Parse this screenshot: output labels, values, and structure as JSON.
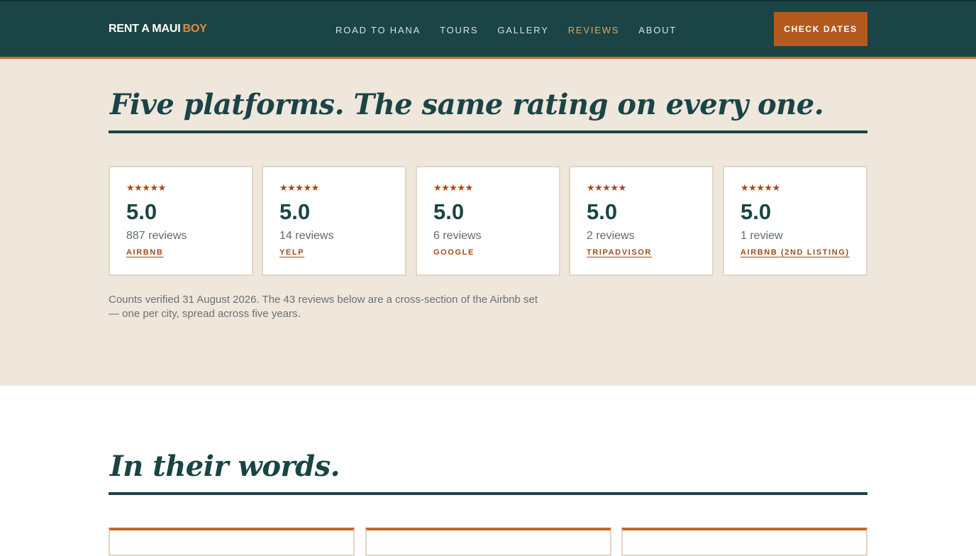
{
  "header": {
    "logo_main": "RENT A MAUI",
    "logo_accent": "BOY",
    "nav": [
      {
        "label": "ROAD TO HANA"
      },
      {
        "label": "TOURS"
      },
      {
        "label": "GALLERY"
      },
      {
        "label": "REVIEWS",
        "active": true
      },
      {
        "label": "ABOUT"
      }
    ],
    "cta_label": "CHECK DATES"
  },
  "ratings_section": {
    "title": "Five platforms. The same rating on every one.",
    "stars": "★★★★★",
    "cards": [
      {
        "rating": "5.0",
        "count": "887 reviews",
        "platform": "AIRBNB"
      },
      {
        "rating": "5.0",
        "count": "14 reviews",
        "platform": "YELP"
      },
      {
        "rating": "5.0",
        "count": "6 reviews",
        "platform": "GOOGLE"
      },
      {
        "rating": "5.0",
        "count": "2 reviews",
        "platform": "TRIPADVISOR"
      },
      {
        "rating": "5.0",
        "count": "1 review",
        "platform": "AIRBNB (2ND LISTING)"
      }
    ],
    "note": "Counts verified 31 August 2026. The 43 reviews below are a cross-section of the Airbnb set — one per city, spread across five years."
  },
  "words_section": {
    "title": "In their words."
  },
  "colors": {
    "header_bg": "#1a4446",
    "accent": "#c8692a",
    "cta_bg": "#b55a1f",
    "band_bg": "#efe6dc",
    "star": "#a24b19"
  }
}
